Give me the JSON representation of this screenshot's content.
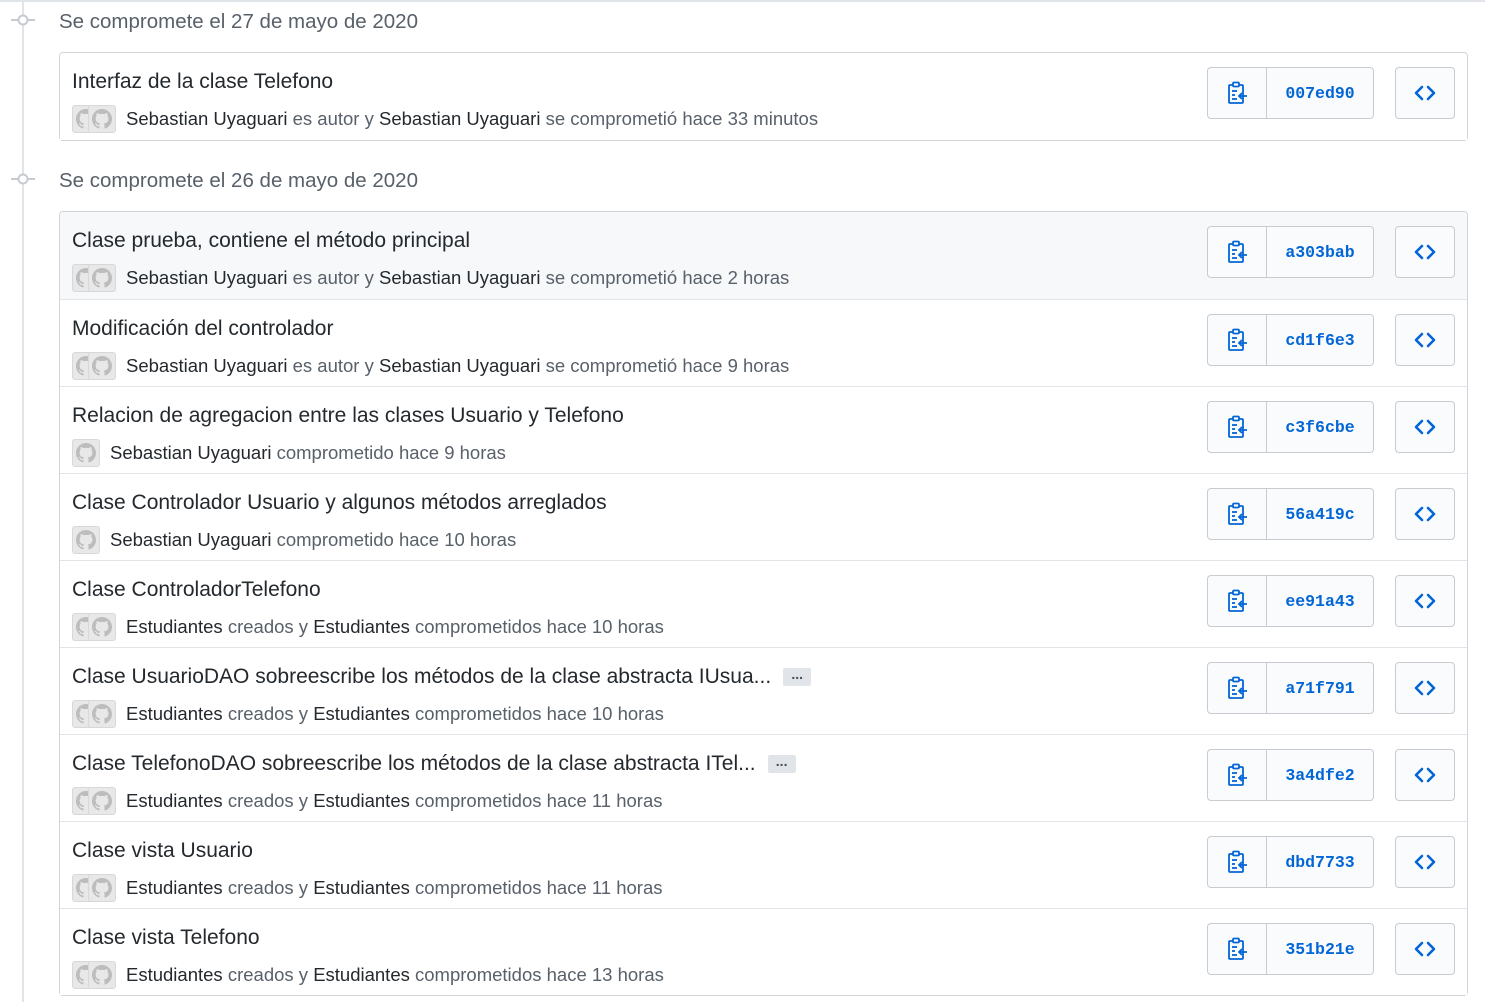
{
  "accent_color": "#0366d6",
  "icons": {
    "timeline": "git-commit-icon",
    "copy": "clipboard-icon",
    "browse": "code-icon",
    "avatar": "github-octocat-icon"
  },
  "days": [
    {
      "label": "Se compromete el 27 de mayo de 2020",
      "commits": [
        {
          "title": "Interfaz de la clase Telefono",
          "truncated": false,
          "meta": [
            [
              "n",
              "Sebastian Uyaguari"
            ],
            [
              "t",
              " es autor y "
            ],
            [
              "n",
              "Sebastian Uyaguari"
            ],
            [
              "t",
              " se comprometió hace 33 minutos"
            ]
          ],
          "avatars": 2,
          "sha": "007ed90"
        }
      ]
    },
    {
      "label": "Se compromete el 26 de mayo de 2020",
      "commits": [
        {
          "title": "Clase prueba, contiene el método principal",
          "truncated": false,
          "hover": true,
          "meta": [
            [
              "n",
              "Sebastian Uyaguari"
            ],
            [
              "t",
              " es autor y "
            ],
            [
              "n",
              "Sebastian Uyaguari"
            ],
            [
              "t",
              " se comprometió hace 2 horas"
            ]
          ],
          "avatars": 2,
          "sha": "a303bab"
        },
        {
          "title": "Modificación del controlador",
          "truncated": false,
          "meta": [
            [
              "n",
              "Sebastian Uyaguari"
            ],
            [
              "t",
              " es autor y "
            ],
            [
              "n",
              "Sebastian Uyaguari"
            ],
            [
              "t",
              " se comprometió hace 9 horas"
            ]
          ],
          "avatars": 2,
          "sha": "cd1f6e3"
        },
        {
          "title": "Relacion de agregacion entre las clases Usuario y Telefono",
          "truncated": false,
          "meta": [
            [
              "n",
              "Sebastian Uyaguari"
            ],
            [
              "t",
              " comprometido hace 9 horas"
            ]
          ],
          "avatars": 1,
          "sha": "c3f6cbe"
        },
        {
          "title": "Clase Controlador Usuario y algunos métodos arreglados",
          "truncated": false,
          "meta": [
            [
              "n",
              "Sebastian Uyaguari"
            ],
            [
              "t",
              " comprometido hace 10 horas"
            ]
          ],
          "avatars": 1,
          "sha": "56a419c"
        },
        {
          "title": "Clase ControladorTelefono",
          "truncated": false,
          "meta": [
            [
              "n",
              "Estudiantes"
            ],
            [
              "t",
              " creados y "
            ],
            [
              "n",
              "Estudiantes"
            ],
            [
              "t",
              " comprometidos hace 10 horas"
            ]
          ],
          "avatars": 2,
          "sha": "ee91a43"
        },
        {
          "title": "Clase UsuarioDAO sobreescribe los métodos de la clase abstracta IUsua...",
          "truncated": true,
          "meta": [
            [
              "n",
              "Estudiantes"
            ],
            [
              "t",
              " creados y "
            ],
            [
              "n",
              "Estudiantes"
            ],
            [
              "t",
              " comprometidos hace 10 horas"
            ]
          ],
          "avatars": 2,
          "sha": "a71f791"
        },
        {
          "title": "Clase TelefonoDAO sobreescribe los métodos de la clase abstracta ITel...",
          "truncated": true,
          "meta": [
            [
              "n",
              "Estudiantes"
            ],
            [
              "t",
              " creados y "
            ],
            [
              "n",
              "Estudiantes"
            ],
            [
              "t",
              " comprometidos hace 11 horas"
            ]
          ],
          "avatars": 2,
          "sha": "3a4dfe2"
        },
        {
          "title": "Clase vista Usuario",
          "truncated": false,
          "meta": [
            [
              "n",
              "Estudiantes"
            ],
            [
              "t",
              " creados y "
            ],
            [
              "n",
              "Estudiantes"
            ],
            [
              "t",
              " comprometidos hace 11 horas"
            ]
          ],
          "avatars": 2,
          "sha": "dbd7733"
        },
        {
          "title": "Clase vista Telefono",
          "truncated": false,
          "meta": [
            [
              "n",
              "Estudiantes"
            ],
            [
              "t",
              " creados y "
            ],
            [
              "n",
              "Estudiantes"
            ],
            [
              "t",
              " comprometidos hace 13 horas"
            ]
          ],
          "avatars": 2,
          "sha": "351b21e"
        }
      ]
    }
  ],
  "ellipsis_label": "..."
}
